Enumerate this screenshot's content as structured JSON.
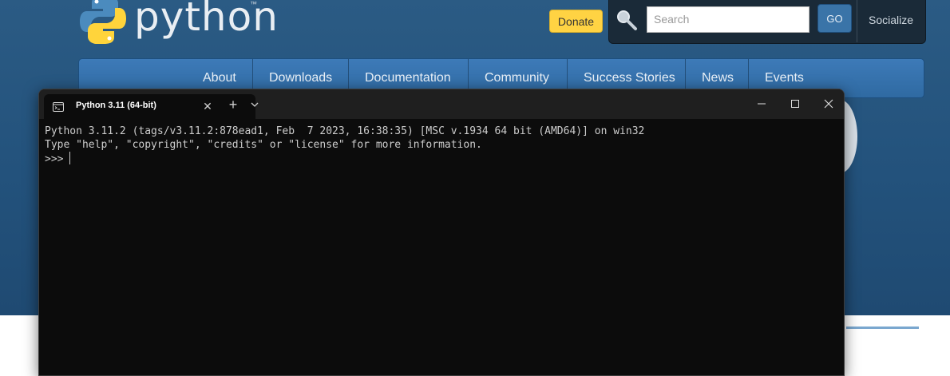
{
  "site": {
    "logo_text": "python",
    "logo_tm": "™",
    "donate_label": "Donate",
    "search_placeholder": "Search",
    "go_label": "GO",
    "socialize_label": "Socialize",
    "nav": [
      "About",
      "Downloads",
      "Documentation",
      "Community",
      "Success Stories",
      "News",
      "Events"
    ],
    "colors": {
      "header_blue": "#2b5b84",
      "donate_yellow": "#ffd343",
      "nav_blue": "#3d7ab8"
    }
  },
  "terminal": {
    "tab_title": "Python 3.11 (64-bit)",
    "tab_icon": "terminal-icon",
    "new_tab_symbol": "+",
    "close_tab_symbol": "✕",
    "window_controls": [
      "minimize-icon",
      "maximize-icon",
      "close-icon"
    ],
    "lines": [
      "Python 3.11.2 (tags/v3.11.2:878ead1, Feb  7 2023, 16:38:35) [MSC v.1934 64 bit (AMD64)] on win32",
      "Type \"help\", \"copyright\", \"credits\" or \"license\" for more information."
    ],
    "prompt": ">>> ",
    "colors": {
      "background": "#0c0c0c",
      "text": "#cccccc",
      "titlebar": "#1f1f1f"
    }
  }
}
